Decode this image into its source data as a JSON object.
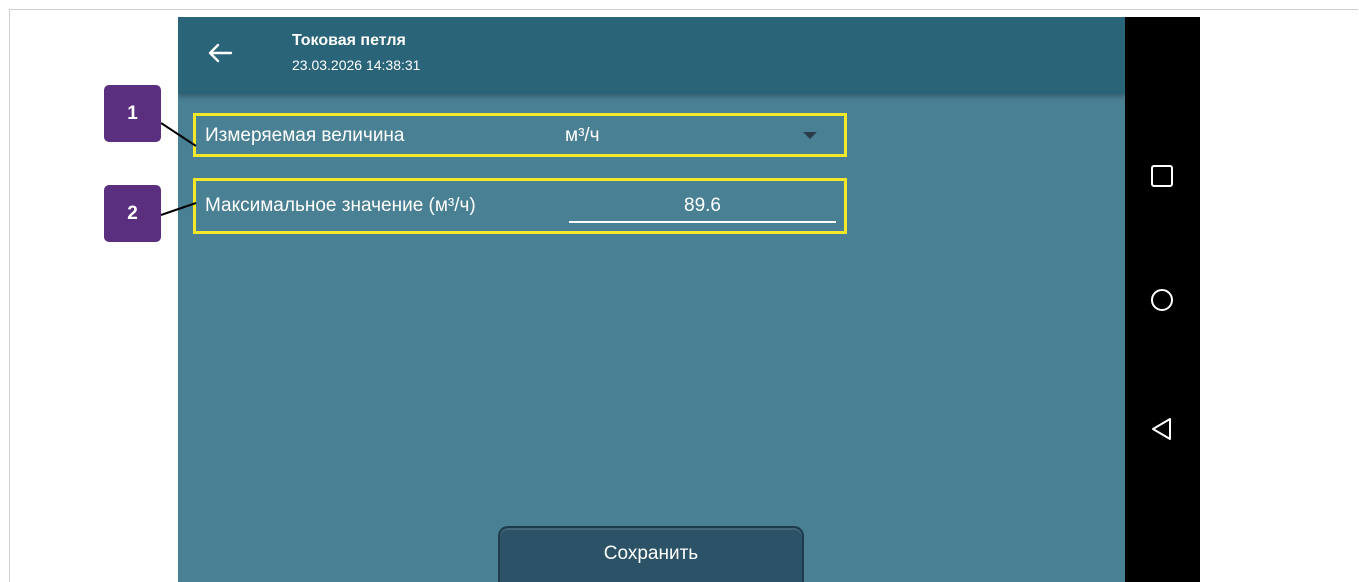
{
  "header": {
    "title": "Токовая петля",
    "timestamp": "23.03.2026 14:38:31",
    "back_icon": "arrow-left-icon"
  },
  "fields": {
    "measured_quantity": {
      "label": "Измеряемая величина",
      "selected_value": "м³/ч",
      "dropdown_icon": "caret-down-icon"
    },
    "max_value": {
      "label": "Максимальное значение (м³/ч)",
      "value": "89.6"
    }
  },
  "actions": {
    "save_label": "Сохранить"
  },
  "callouts": {
    "first": "1",
    "second": "2"
  },
  "system_nav": {
    "items": [
      "recents-square-icon",
      "home-circle-icon",
      "back-triangle-icon"
    ]
  },
  "colors": {
    "appbar": "#2a6479",
    "background": "#4a8094",
    "highlight": "#f5e829",
    "callout": "#5b2f80",
    "button": "#2b5266"
  }
}
